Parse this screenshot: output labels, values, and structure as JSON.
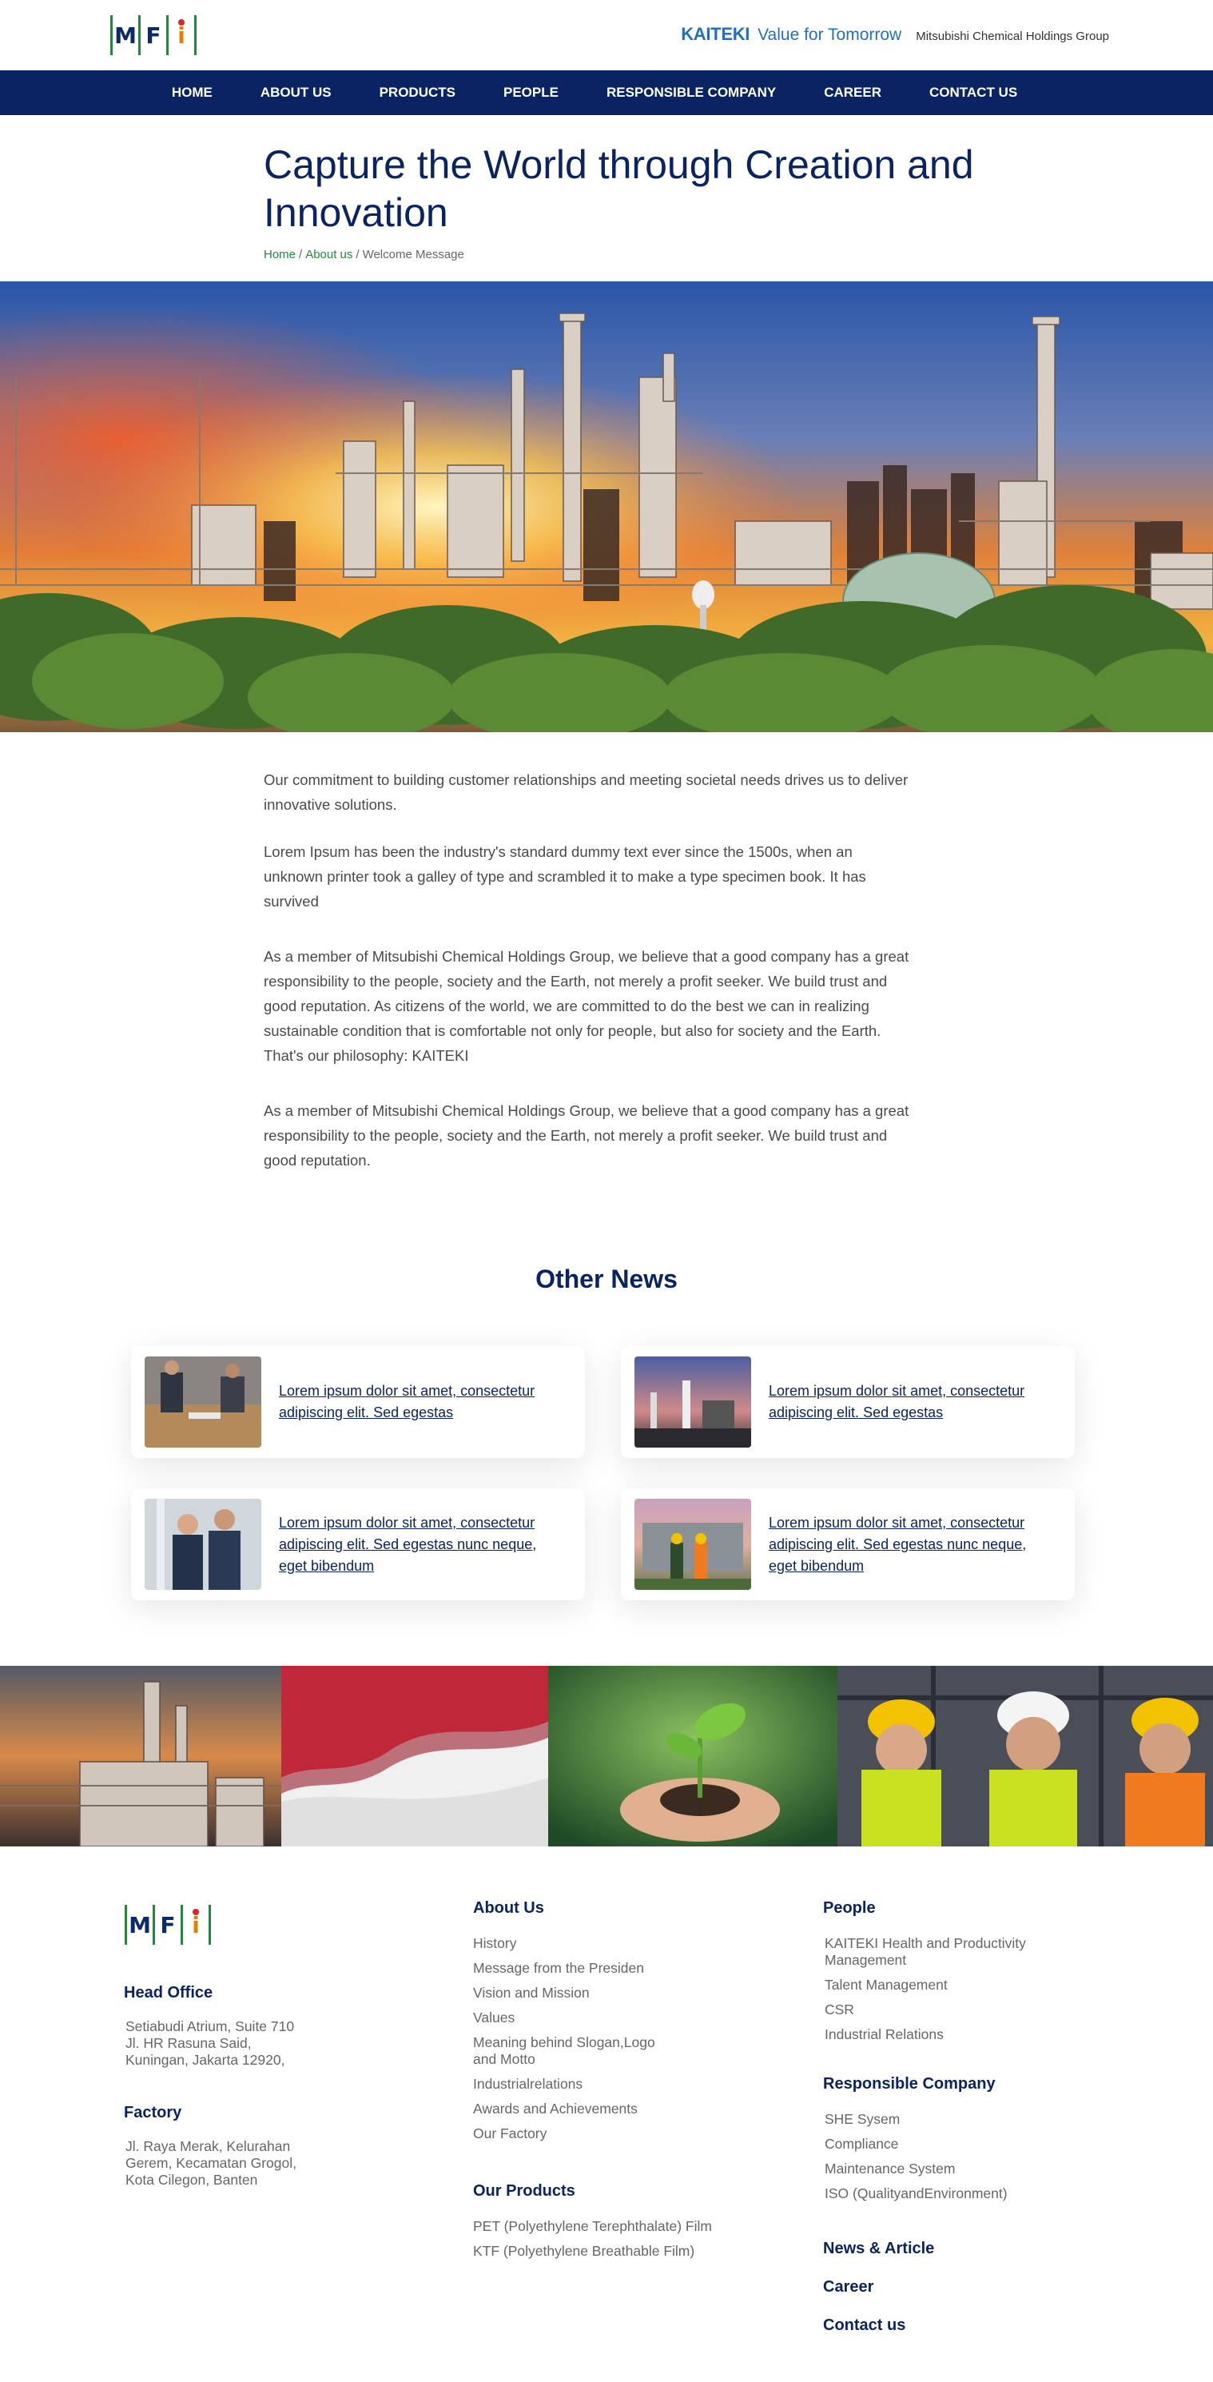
{
  "header": {
    "logo_letters": [
      "M",
      "F",
      "i"
    ],
    "kaiteki_brand": "KAITEKI",
    "kaiteki_tagline": "Value for Tomorrow",
    "group_name": "Mitsubishi Chemical Holdings Group"
  },
  "nav": {
    "items": [
      "HOME",
      "ABOUT US",
      "PRODUCTS",
      "PEOPLE",
      "RESPONSIBLE COMPANY",
      "CAREER",
      "CONTACT US"
    ]
  },
  "page": {
    "title": "Capture the World through Creation and Innovation",
    "breadcrumb": [
      "Home",
      "About us",
      "Welcome Message"
    ]
  },
  "body": {
    "paragraphs": [
      "Our commitment to building customer relationships and meeting societal needs drives us to deliver innovative solutions.",
      "Lorem Ipsum has been the industry's standard dummy text ever since the 1500s, when an unknown printer took a galley of type and scrambled it to make a type specimen book. It has survived",
      "As a member of Mitsubishi Chemical Holdings Group, we believe that a good company has a great responsibility to the people, society and the Earth, not merely a profit seeker. We build trust and good reputation. As citizens of the world, we are committed to do the best we can in realizing sustainable condition that is comfortable not only for people, but also for society and the Earth. That's our philosophy: KAITEKI",
      "As a member of Mitsubishi Chemical Holdings Group, we believe that a good company has a great responsibility to the people, society and the Earth, not merely a profit seeker. We build trust and good reputation."
    ]
  },
  "news": {
    "title": "Other News",
    "items": [
      {
        "title": "Lorem ipsum dolor sit amet, consectetur adipiscing elit. Sed egestas "
      },
      {
        "title": "Lorem ipsum dolor sit amet, consectetur adipiscing elit. Sed egestas "
      },
      {
        "title": "Lorem ipsum dolor sit amet, consectetur adipiscing elit. Sed egestas nunc neque, eget bibendum"
      },
      {
        "title": "Lorem ipsum dolor sit amet, consectetur adipiscing elit. Sed egestas nunc neque, eget bibendum"
      }
    ]
  },
  "footer": {
    "head_office": {
      "heading": "Head Office",
      "lines": [
        "Setiabudi Atrium, Suite 710",
        "Jl. HR Rasuna Said,",
        "Kuningan, Jakarta 12920,"
      ]
    },
    "factory": {
      "heading": "Factory",
      "lines": [
        "Jl. Raya Merak, Kelurahan",
        "Gerem, Kecamatan Grogol,",
        "Kota Cilegon, Banten"
      ]
    },
    "about": {
      "heading": "About Us",
      "links": [
        "History",
        "Message from the Presiden",
        "Vision and Mission",
        "Values",
        "Meaning behind Slogan,Logo and Motto",
        "Industrialrelations",
        "Awards and Achievements",
        "Our Factory"
      ]
    },
    "products": {
      "heading": "Our Products",
      "links": [
        "PET (Polyethylene Terephthalate) Film",
        "KTF (Polyethylene Breathable Film)"
      ]
    },
    "people": {
      "heading": "People",
      "links": [
        "KAITEKI Health and Productivity Management",
        "Talent Management",
        "CSR",
        "Industrial Relations"
      ]
    },
    "responsible": {
      "heading": "Responsible Company",
      "links": [
        "SHE Sysem",
        "Compliance",
        "Maintenance System",
        "ISO (QualityandEnvironment)"
      ]
    },
    "extra_links": [
      "News & Article",
      "Career",
      "Contact us"
    ]
  },
  "colors": {
    "navy": "#0a2463",
    "green": "#1f8a3c",
    "kaiteki_blue": "#1f6fc9",
    "logo_orange": "#e67e00"
  }
}
